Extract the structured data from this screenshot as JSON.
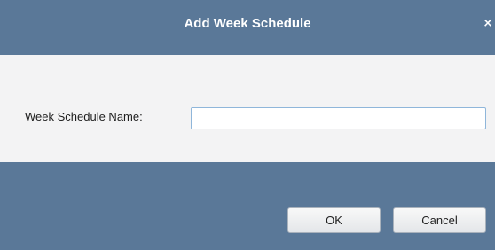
{
  "dialog": {
    "title": "Add Week Schedule",
    "close_glyph": "×",
    "close_icon": "close-icon"
  },
  "form": {
    "name_label": "Week Schedule Name:",
    "name_value": "",
    "name_placeholder": ""
  },
  "buttons": {
    "ok_label": "OK",
    "cancel_label": "Cancel"
  },
  "colors": {
    "title_bar": "#5a7898",
    "content_background": "#f3f3f4",
    "input_border": "#8fb6da"
  }
}
